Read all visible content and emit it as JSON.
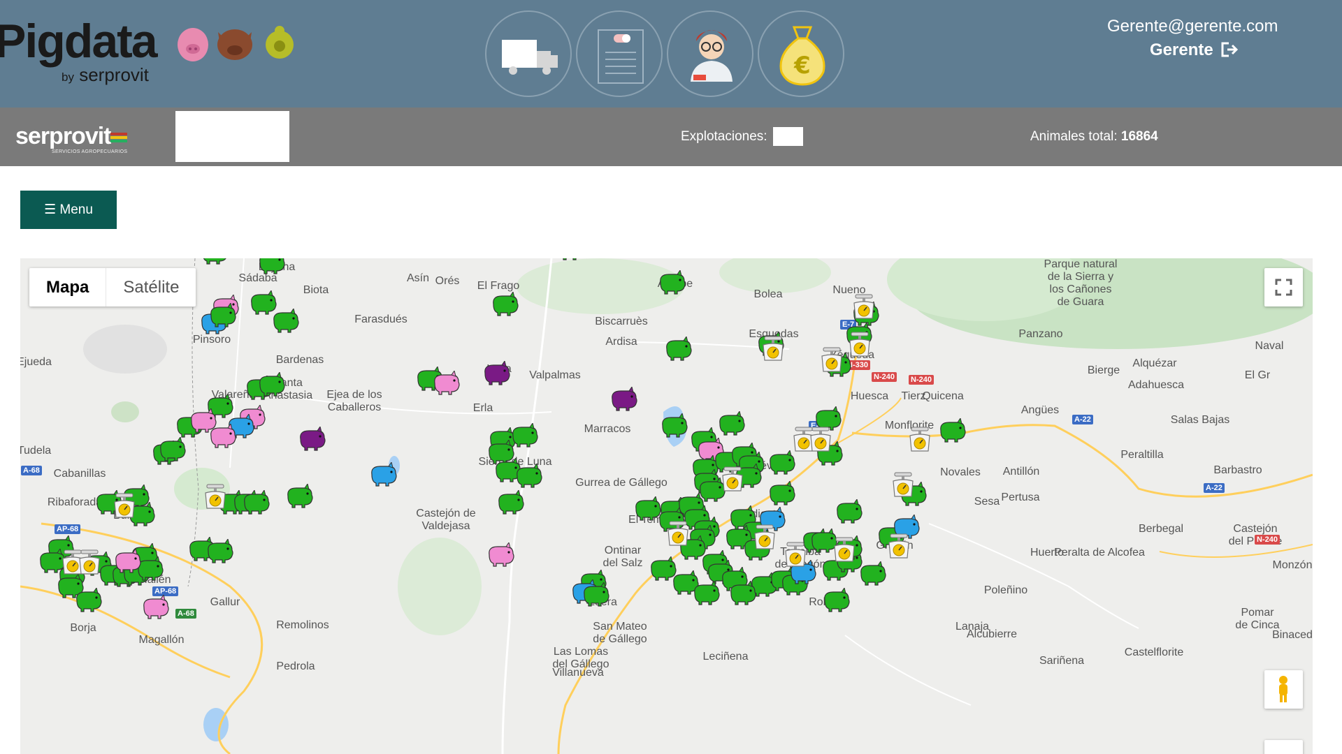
{
  "header": {
    "logo": {
      "brand": "Pigdata",
      "by": "by",
      "company": "serprovit"
    },
    "nav_icons": [
      "truck-icon",
      "document-icon",
      "veterinarian-icon",
      "money-bag-icon"
    ],
    "user_email": "Gerente@gerente.com",
    "user_role": "Gerente"
  },
  "subbar": {
    "logo_text": "serprovit",
    "logo_tagline": "SERVICIOS AGROPECUARIOS",
    "explotaciones_label": "Explotaciones:",
    "animals_label": "Animales total:",
    "animals_total": "16864"
  },
  "menu_button": "☰ Menu",
  "map": {
    "type_buttons": {
      "map": "Mapa",
      "satellite": "Satélite"
    },
    "places": [
      "Layana",
      "Sádaba",
      "Asín",
      "Orés",
      "El Frago",
      "Ayerbe",
      "Bolea",
      "Nueno",
      "Parque natural\nde la Sierra y\nlos Cañones\nde Guara",
      "Biota",
      "Farasdués",
      "Biscarruès",
      "Esquedas",
      "Panzano",
      "Naval",
      "Pinsoro",
      "Ardisa",
      "Yéqueda",
      "Alquézar",
      "Ejueda",
      "Bardenas",
      "Luna",
      "Valpalmas",
      "Bierge",
      "Adahuesca",
      "El Gr",
      "Santa\nAnastasia",
      "Valareña",
      "Ejea de los\nCaballeros",
      "Huesca",
      "Tierz",
      "Quicena",
      "Angües",
      "Erla",
      "Salas Bajas",
      "Monflorite",
      "Tudela",
      "Marracos",
      "Cabanillas",
      "Sierra de Luna",
      "Almudévar",
      "Peraltilla",
      "Novales",
      "Antillón",
      "Barbastro",
      "Ribaforada",
      "Pertusa",
      "Gurrea de Gállego",
      "Sesa",
      "Buñuel",
      "Castejón de\nValdejasa",
      "Tardienta",
      "El Temple",
      "Berbegal",
      "Castejón\ndel Puente",
      "Ontinar\ndel Salz",
      "Torralba\nde Aragón",
      "Grañén",
      "Huerto",
      "Peralta de Alcofea",
      "Monzón",
      "Mallén",
      "Zuera",
      "Robres",
      "Lanaja",
      "Gallur",
      "Remolinos",
      "Poleñino",
      "Pomar\nde Cinca",
      "Borja",
      "Magallón",
      "San Mateo\nde Gállego",
      "Alcubierre",
      "Binaced",
      "Las Lomas\ndel Gállego",
      "Leciñena",
      "Sariñena",
      "Castelflorite",
      "Pedrola",
      "Villanueva"
    ],
    "roads": [
      "A-68",
      "AP-68",
      "AP-68",
      "E-7",
      "E-7",
      "N-330",
      "N-240",
      "N-240",
      "A-22",
      "A-22",
      "N-240",
      "A-68"
    ],
    "legend_colors": {
      "green": "#22b21f",
      "pink": "#f08bd1",
      "blue": "#2aa1e6",
      "purple": "#7a1a85"
    }
  }
}
